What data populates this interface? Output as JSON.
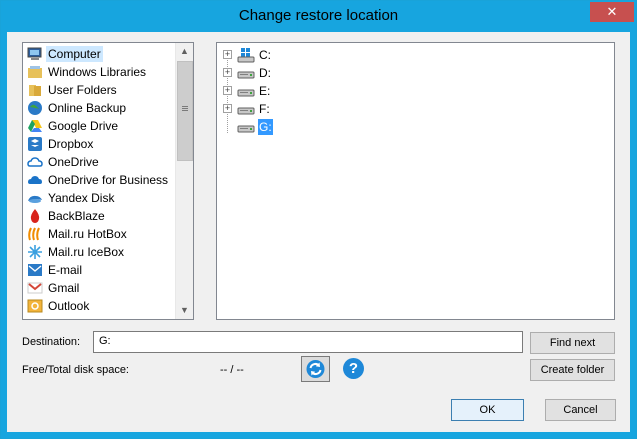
{
  "window": {
    "title": "Change restore location",
    "close_glyph": "✕"
  },
  "locations": [
    {
      "label": "Computer",
      "icon": "computer-icon",
      "selected": true
    },
    {
      "label": "Windows Libraries",
      "icon": "libraries-icon"
    },
    {
      "label": "User Folders",
      "icon": "user-folders-icon"
    },
    {
      "label": "Online Backup",
      "icon": "online-backup-icon"
    },
    {
      "label": "Google Drive",
      "icon": "google-drive-icon"
    },
    {
      "label": "Dropbox",
      "icon": "dropbox-icon"
    },
    {
      "label": "OneDrive",
      "icon": "onedrive-icon"
    },
    {
      "label": "OneDrive for Business",
      "icon": "onedrive-business-icon"
    },
    {
      "label": "Yandex Disk",
      "icon": "yandex-disk-icon"
    },
    {
      "label": "BackBlaze",
      "icon": "backblaze-icon"
    },
    {
      "label": "Mail.ru HotBox",
      "icon": "mailru-hotbox-icon"
    },
    {
      "label": "Mail.ru IceBox",
      "icon": "mailru-icebox-icon"
    },
    {
      "label": "E-mail",
      "icon": "email-icon"
    },
    {
      "label": "Gmail",
      "icon": "gmail-icon"
    },
    {
      "label": "Outlook",
      "icon": "outlook-icon"
    }
  ],
  "drives": [
    {
      "label": "C:",
      "icon": "windows-drive-icon",
      "expandable": true
    },
    {
      "label": "D:",
      "icon": "drive-icon",
      "expandable": true
    },
    {
      "label": "E:",
      "icon": "drive-icon",
      "expandable": true
    },
    {
      "label": "F:",
      "icon": "drive-icon",
      "expandable": true
    },
    {
      "label": "G:",
      "icon": "drive-icon",
      "expandable": false,
      "selected": true
    }
  ],
  "destination": {
    "label": "Destination:",
    "value": "G:"
  },
  "diskspace": {
    "label": "Free/Total disk space:",
    "value": "-- / --"
  },
  "buttons": {
    "find_next": "Find next",
    "create_folder": "Create folder",
    "ok": "OK",
    "cancel": "Cancel",
    "help": "?"
  },
  "colors": {
    "titlebar": "#17a5df",
    "close": "#c7504f",
    "selection": "#3399ff"
  }
}
